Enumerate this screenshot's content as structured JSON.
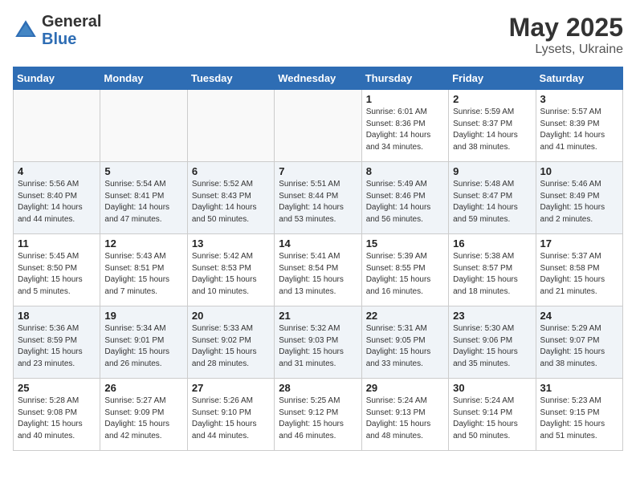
{
  "header": {
    "logo_general": "General",
    "logo_blue": "Blue",
    "month": "May 2025",
    "location": "Lysets, Ukraine"
  },
  "days_of_week": [
    "Sunday",
    "Monday",
    "Tuesday",
    "Wednesday",
    "Thursday",
    "Friday",
    "Saturday"
  ],
  "weeks": [
    [
      {
        "day": "",
        "info": ""
      },
      {
        "day": "",
        "info": ""
      },
      {
        "day": "",
        "info": ""
      },
      {
        "day": "",
        "info": ""
      },
      {
        "day": "1",
        "info": "Sunrise: 6:01 AM\nSunset: 8:36 PM\nDaylight: 14 hours\nand 34 minutes."
      },
      {
        "day": "2",
        "info": "Sunrise: 5:59 AM\nSunset: 8:37 PM\nDaylight: 14 hours\nand 38 minutes."
      },
      {
        "day": "3",
        "info": "Sunrise: 5:57 AM\nSunset: 8:39 PM\nDaylight: 14 hours\nand 41 minutes."
      }
    ],
    [
      {
        "day": "4",
        "info": "Sunrise: 5:56 AM\nSunset: 8:40 PM\nDaylight: 14 hours\nand 44 minutes."
      },
      {
        "day": "5",
        "info": "Sunrise: 5:54 AM\nSunset: 8:41 PM\nDaylight: 14 hours\nand 47 minutes."
      },
      {
        "day": "6",
        "info": "Sunrise: 5:52 AM\nSunset: 8:43 PM\nDaylight: 14 hours\nand 50 minutes."
      },
      {
        "day": "7",
        "info": "Sunrise: 5:51 AM\nSunset: 8:44 PM\nDaylight: 14 hours\nand 53 minutes."
      },
      {
        "day": "8",
        "info": "Sunrise: 5:49 AM\nSunset: 8:46 PM\nDaylight: 14 hours\nand 56 minutes."
      },
      {
        "day": "9",
        "info": "Sunrise: 5:48 AM\nSunset: 8:47 PM\nDaylight: 14 hours\nand 59 minutes."
      },
      {
        "day": "10",
        "info": "Sunrise: 5:46 AM\nSunset: 8:49 PM\nDaylight: 15 hours\nand 2 minutes."
      }
    ],
    [
      {
        "day": "11",
        "info": "Sunrise: 5:45 AM\nSunset: 8:50 PM\nDaylight: 15 hours\nand 5 minutes."
      },
      {
        "day": "12",
        "info": "Sunrise: 5:43 AM\nSunset: 8:51 PM\nDaylight: 15 hours\nand 7 minutes."
      },
      {
        "day": "13",
        "info": "Sunrise: 5:42 AM\nSunset: 8:53 PM\nDaylight: 15 hours\nand 10 minutes."
      },
      {
        "day": "14",
        "info": "Sunrise: 5:41 AM\nSunset: 8:54 PM\nDaylight: 15 hours\nand 13 minutes."
      },
      {
        "day": "15",
        "info": "Sunrise: 5:39 AM\nSunset: 8:55 PM\nDaylight: 15 hours\nand 16 minutes."
      },
      {
        "day": "16",
        "info": "Sunrise: 5:38 AM\nSunset: 8:57 PM\nDaylight: 15 hours\nand 18 minutes."
      },
      {
        "day": "17",
        "info": "Sunrise: 5:37 AM\nSunset: 8:58 PM\nDaylight: 15 hours\nand 21 minutes."
      }
    ],
    [
      {
        "day": "18",
        "info": "Sunrise: 5:36 AM\nSunset: 8:59 PM\nDaylight: 15 hours\nand 23 minutes."
      },
      {
        "day": "19",
        "info": "Sunrise: 5:34 AM\nSunset: 9:01 PM\nDaylight: 15 hours\nand 26 minutes."
      },
      {
        "day": "20",
        "info": "Sunrise: 5:33 AM\nSunset: 9:02 PM\nDaylight: 15 hours\nand 28 minutes."
      },
      {
        "day": "21",
        "info": "Sunrise: 5:32 AM\nSunset: 9:03 PM\nDaylight: 15 hours\nand 31 minutes."
      },
      {
        "day": "22",
        "info": "Sunrise: 5:31 AM\nSunset: 9:05 PM\nDaylight: 15 hours\nand 33 minutes."
      },
      {
        "day": "23",
        "info": "Sunrise: 5:30 AM\nSunset: 9:06 PM\nDaylight: 15 hours\nand 35 minutes."
      },
      {
        "day": "24",
        "info": "Sunrise: 5:29 AM\nSunset: 9:07 PM\nDaylight: 15 hours\nand 38 minutes."
      }
    ],
    [
      {
        "day": "25",
        "info": "Sunrise: 5:28 AM\nSunset: 9:08 PM\nDaylight: 15 hours\nand 40 minutes."
      },
      {
        "day": "26",
        "info": "Sunrise: 5:27 AM\nSunset: 9:09 PM\nDaylight: 15 hours\nand 42 minutes."
      },
      {
        "day": "27",
        "info": "Sunrise: 5:26 AM\nSunset: 9:10 PM\nDaylight: 15 hours\nand 44 minutes."
      },
      {
        "day": "28",
        "info": "Sunrise: 5:25 AM\nSunset: 9:12 PM\nDaylight: 15 hours\nand 46 minutes."
      },
      {
        "day": "29",
        "info": "Sunrise: 5:24 AM\nSunset: 9:13 PM\nDaylight: 15 hours\nand 48 minutes."
      },
      {
        "day": "30",
        "info": "Sunrise: 5:24 AM\nSunset: 9:14 PM\nDaylight: 15 hours\nand 50 minutes."
      },
      {
        "day": "31",
        "info": "Sunrise: 5:23 AM\nSunset: 9:15 PM\nDaylight: 15 hours\nand 51 minutes."
      }
    ]
  ]
}
